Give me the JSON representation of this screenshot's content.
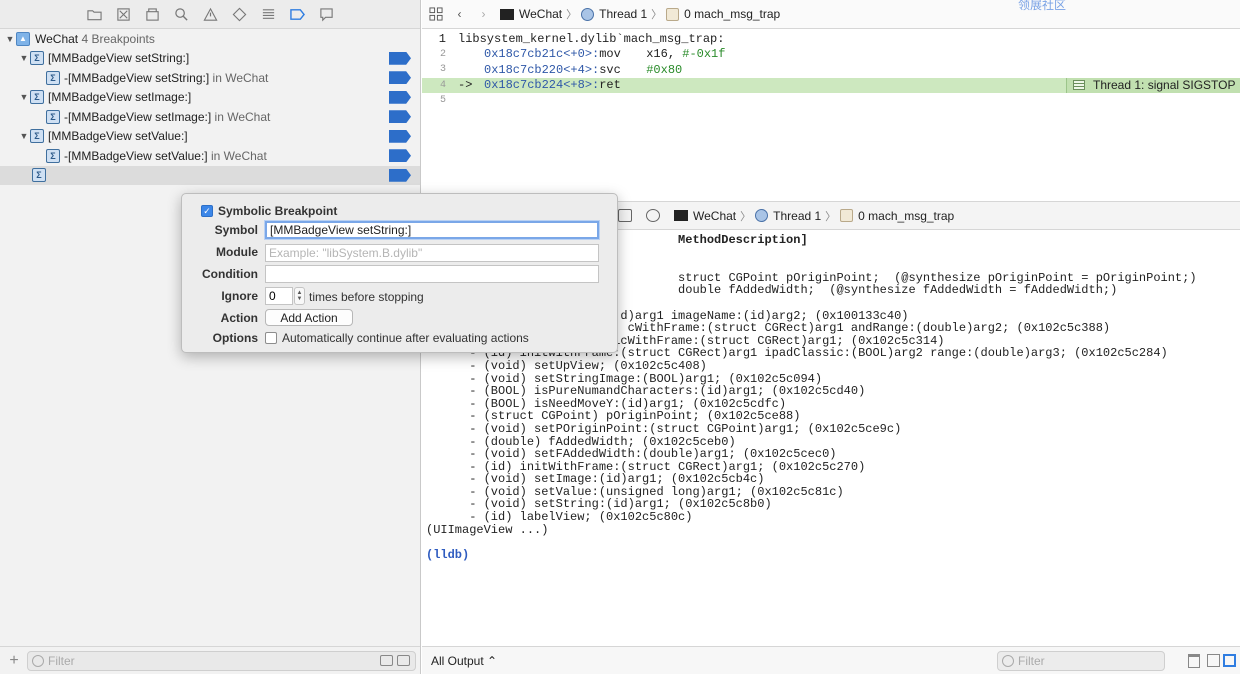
{
  "navigator": {
    "breakpoints": {
      "project_name": "WeChat",
      "project_count": "4 Breakpoints",
      "groups": [
        {
          "symbol": "[MMBadgeView setString:]",
          "child_prefix": "-",
          "child_symbol": "[MMBadgeView setString:]",
          "child_module_prefix": "in",
          "child_module": "WeChat"
        },
        {
          "symbol": "[MMBadgeView setImage:]",
          "child_prefix": "-",
          "child_symbol": "[MMBadgeView setImage:]",
          "child_module_prefix": "in",
          "child_module": "WeChat"
        },
        {
          "symbol": "[MMBadgeView setValue:]",
          "child_prefix": "-",
          "child_symbol": "[MMBadgeView setValue:]",
          "child_module_prefix": "in",
          "child_module": "WeChat"
        }
      ]
    },
    "filter_placeholder": "Filter"
  },
  "jump_bar": {
    "app": "WeChat",
    "thread": "Thread 1",
    "frame": "0 mach_msg_trap",
    "watermark": "领展社区"
  },
  "disassembly": {
    "lines": [
      {
        "num": "1",
        "header": "libsystem_kernel.dylib`mach_msg_trap:"
      },
      {
        "num": "2",
        "arrow": "",
        "addr": "0x18c7cb21c",
        "off": "<+0>:",
        "op": "mov",
        "args": "x16, ",
        "imm": "#-0x1f"
      },
      {
        "num": "3",
        "arrow": "",
        "addr": "0x18c7cb220",
        "off": "<+4>:",
        "op": "svc",
        "args": "",
        "imm": "#0x80"
      },
      {
        "num": "4",
        "arrow": "->",
        "addr": "0x18c7cb224",
        "off": "<+8>:",
        "op": "ret",
        "args": "",
        "imm": ""
      },
      {
        "num": "5"
      }
    ],
    "signal_badge": "Thread 1: signal SIGSTOP"
  },
  "debug_bar": {
    "app": "WeChat",
    "thread": "Thread 1",
    "frame": "0 mach_msg_trap"
  },
  "console": {
    "lines": [
      "                                   MethodDescription]",
      "",
      "",
      "                                   struct CGPoint pOriginPoint;  (@synthesize pOriginPoint = pOriginPoint;)",
      "                                   double fAddedWidth;  (@synthesize fAddedWidth = fAddedWidth;)",
      "",
      "                           d)arg1 imageName:(id)arg2; (0x100133c40)",
      "                            cWithFrame:(struct CGRect)arg1 andRange:(double)arg2; (0x102c5c388)",
      "      - (id) initIpadClassicWithFrame:(struct CGRect)arg1; (0x102c5c314)",
      "      - (id) initWithFrame:(struct CGRect)arg1 ipadClassic:(BOOL)arg2 range:(double)arg3; (0x102c5c284)",
      "      - (void) setUpView; (0x102c5c408)",
      "      - (void) setStringImage:(BOOL)arg1; (0x102c5c094)",
      "      - (BOOL) isPureNumandCharacters:(id)arg1; (0x102c5cd40)",
      "      - (BOOL) isNeedMoveY:(id)arg1; (0x102c5cdfc)",
      "      - (struct CGPoint) pOriginPoint; (0x102c5ce88)",
      "      - (void) setPOriginPoint:(struct CGPoint)arg1; (0x102c5ce9c)",
      "      - (double) fAddedWidth; (0x102c5ceb0)",
      "      - (void) setFAddedWidth:(double)arg1; (0x102c5cec0)",
      "      - (id) initWithFrame:(struct CGRect)arg1; (0x102c5c270)",
      "      - (void) setImage:(id)arg1; (0x102c5cb4c)",
      "      - (void) setValue:(unsigned long)arg1; (0x102c5c81c)",
      "      - (void) setString:(id)arg1; (0x102c5c8b0)",
      "      - (id) labelView; (0x102c5c80c)",
      "(UIImageView ...)"
    ],
    "prompt": "(lldb)",
    "output_selector": "All Output ⌃",
    "filter_placeholder": "Filter"
  },
  "popover": {
    "title": "Symbolic Breakpoint",
    "title_checked": true,
    "symbol_label": "Symbol",
    "symbol_value": "[MMBadgeView setString:]",
    "module_label": "Module",
    "module_placeholder": "Example: \"libSystem.B.dylib\"",
    "condition_label": "Condition",
    "condition_value": "",
    "ignore_label": "Ignore",
    "ignore_value": "0",
    "ignore_suffix": "times before stopping",
    "action_label": "Action",
    "add_action": "Add Action",
    "options_label": "Options",
    "options_text": "Automatically continue after evaluating actions"
  },
  "colors": {
    "accent": "#2f7de1",
    "breakpoint_flag": "#2d6ec9",
    "current_line": "#cde8bf",
    "address": "#2f58a8",
    "immediate": "#2a8b2a"
  }
}
